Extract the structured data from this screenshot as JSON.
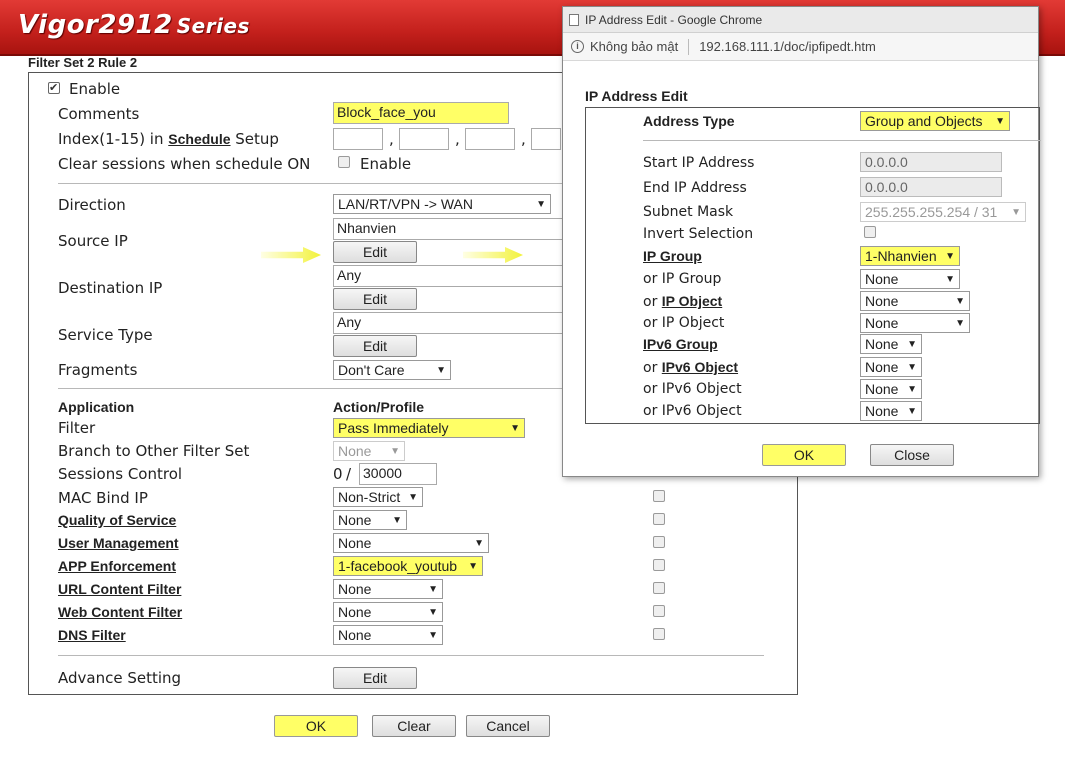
{
  "header": {
    "brand": "Vigor2912",
    "series": "Series"
  },
  "filter_title": "Filter Set 2 Rule 2",
  "form": {
    "enable_label": "Enable",
    "comments_label": "Comments",
    "comments_value": "Block_face_you",
    "index_label_prefix": "Index(1-15) in ",
    "index_link": "Schedule",
    "index_label_suffix": " Setup",
    "comma": ",",
    "clear_sessions_label": "Clear sessions when schedule ON",
    "clear_enable_label": "Enable",
    "direction_label": "Direction",
    "direction_value": "LAN/RT/VPN -> WAN",
    "source_ip_label": "Source IP",
    "source_ip_value": "Nhanvien",
    "destination_ip_label": "Destination IP",
    "destination_ip_value": "Any",
    "service_type_label": "Service Type",
    "service_type_value": "Any",
    "edit_label": "Edit",
    "fragments_label": "Fragments",
    "fragments_value": "Don't Care",
    "application_label": "Application",
    "action_profile_label": "Action/Profile",
    "filter_label": "Filter",
    "filter_value": "Pass Immediately",
    "branch_label": "Branch to Other Filter Set",
    "branch_value": "None",
    "sessions_label": "Sessions Control",
    "sessions_current": "0",
    "sessions_slash": "/",
    "sessions_max": "30000",
    "mac_label": "MAC Bind IP",
    "mac_value": "Non-Strict",
    "qos_label": "Quality of Service",
    "qos_value": "None",
    "user_mgmt_label": "User Management",
    "user_mgmt_value": "None",
    "app_enf_label": "APP Enforcement",
    "app_enf_value": "1-facebook_youtub",
    "url_filter_label": "URL Content Filter",
    "url_filter_value": "None",
    "web_filter_label": "Web Content Filter",
    "web_filter_value": "None",
    "dns_filter_label": "DNS Filter",
    "dns_filter_value": "None",
    "advance_label": "Advance Setting"
  },
  "buttons": {
    "ok": "OK",
    "clear": "Clear",
    "cancel": "Cancel"
  },
  "popup": {
    "window_title": "IP Address Edit - Google Chrome",
    "security_label": "Không bảo mật",
    "url": "192.168.111.1/doc/ipfipedt.htm",
    "heading": "IP Address Edit",
    "address_type_label": "Address Type",
    "address_type_value": "Group and Objects",
    "start_ip_label": "Start IP Address",
    "start_ip_value": "0.0.0.0",
    "end_ip_label": "End IP Address",
    "end_ip_value": "0.0.0.0",
    "subnet_label": "Subnet Mask",
    "subnet_value": "255.255.255.254 / 31",
    "invert_label": "Invert Selection",
    "ip_group_label": "IP Group",
    "ip_group_value": "1-Nhanvien",
    "or_ip_group_label": "or IP Group",
    "or_prefix": "or ",
    "ip_object_link": "IP Object",
    "or_ip_object_label": "or IP Object",
    "ipv6_group_label": "IPv6 Group",
    "ipv6_object_link": "IPv6 Object",
    "or_ipv6_object_label": "or IPv6 Object",
    "none": "None",
    "ok": "OK",
    "close": "Close"
  }
}
